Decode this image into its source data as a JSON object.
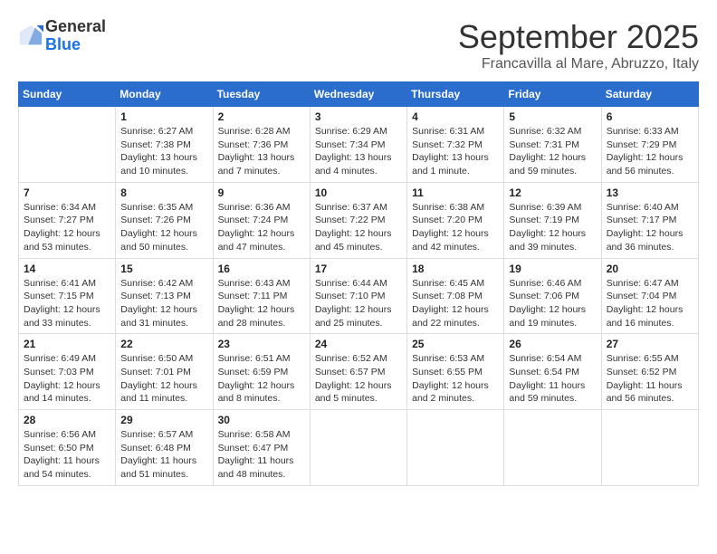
{
  "logo": {
    "general": "General",
    "blue": "Blue"
  },
  "title": {
    "month": "September 2025",
    "location": "Francavilla al Mare, Abruzzo, Italy"
  },
  "headers": [
    "Sunday",
    "Monday",
    "Tuesday",
    "Wednesday",
    "Thursday",
    "Friday",
    "Saturday"
  ],
  "weeks": [
    [
      {
        "day": "",
        "info": ""
      },
      {
        "day": "1",
        "info": "Sunrise: 6:27 AM\nSunset: 7:38 PM\nDaylight: 13 hours\nand 10 minutes."
      },
      {
        "day": "2",
        "info": "Sunrise: 6:28 AM\nSunset: 7:36 PM\nDaylight: 13 hours\nand 7 minutes."
      },
      {
        "day": "3",
        "info": "Sunrise: 6:29 AM\nSunset: 7:34 PM\nDaylight: 13 hours\nand 4 minutes."
      },
      {
        "day": "4",
        "info": "Sunrise: 6:31 AM\nSunset: 7:32 PM\nDaylight: 13 hours\nand 1 minute."
      },
      {
        "day": "5",
        "info": "Sunrise: 6:32 AM\nSunset: 7:31 PM\nDaylight: 12 hours\nand 59 minutes."
      },
      {
        "day": "6",
        "info": "Sunrise: 6:33 AM\nSunset: 7:29 PM\nDaylight: 12 hours\nand 56 minutes."
      }
    ],
    [
      {
        "day": "7",
        "info": "Sunrise: 6:34 AM\nSunset: 7:27 PM\nDaylight: 12 hours\nand 53 minutes."
      },
      {
        "day": "8",
        "info": "Sunrise: 6:35 AM\nSunset: 7:26 PM\nDaylight: 12 hours\nand 50 minutes."
      },
      {
        "day": "9",
        "info": "Sunrise: 6:36 AM\nSunset: 7:24 PM\nDaylight: 12 hours\nand 47 minutes."
      },
      {
        "day": "10",
        "info": "Sunrise: 6:37 AM\nSunset: 7:22 PM\nDaylight: 12 hours\nand 45 minutes."
      },
      {
        "day": "11",
        "info": "Sunrise: 6:38 AM\nSunset: 7:20 PM\nDaylight: 12 hours\nand 42 minutes."
      },
      {
        "day": "12",
        "info": "Sunrise: 6:39 AM\nSunset: 7:19 PM\nDaylight: 12 hours\nand 39 minutes."
      },
      {
        "day": "13",
        "info": "Sunrise: 6:40 AM\nSunset: 7:17 PM\nDaylight: 12 hours\nand 36 minutes."
      }
    ],
    [
      {
        "day": "14",
        "info": "Sunrise: 6:41 AM\nSunset: 7:15 PM\nDaylight: 12 hours\nand 33 minutes."
      },
      {
        "day": "15",
        "info": "Sunrise: 6:42 AM\nSunset: 7:13 PM\nDaylight: 12 hours\nand 31 minutes."
      },
      {
        "day": "16",
        "info": "Sunrise: 6:43 AM\nSunset: 7:11 PM\nDaylight: 12 hours\nand 28 minutes."
      },
      {
        "day": "17",
        "info": "Sunrise: 6:44 AM\nSunset: 7:10 PM\nDaylight: 12 hours\nand 25 minutes."
      },
      {
        "day": "18",
        "info": "Sunrise: 6:45 AM\nSunset: 7:08 PM\nDaylight: 12 hours\nand 22 minutes."
      },
      {
        "day": "19",
        "info": "Sunrise: 6:46 AM\nSunset: 7:06 PM\nDaylight: 12 hours\nand 19 minutes."
      },
      {
        "day": "20",
        "info": "Sunrise: 6:47 AM\nSunset: 7:04 PM\nDaylight: 12 hours\nand 16 minutes."
      }
    ],
    [
      {
        "day": "21",
        "info": "Sunrise: 6:49 AM\nSunset: 7:03 PM\nDaylight: 12 hours\nand 14 minutes."
      },
      {
        "day": "22",
        "info": "Sunrise: 6:50 AM\nSunset: 7:01 PM\nDaylight: 12 hours\nand 11 minutes."
      },
      {
        "day": "23",
        "info": "Sunrise: 6:51 AM\nSunset: 6:59 PM\nDaylight: 12 hours\nand 8 minutes."
      },
      {
        "day": "24",
        "info": "Sunrise: 6:52 AM\nSunset: 6:57 PM\nDaylight: 12 hours\nand 5 minutes."
      },
      {
        "day": "25",
        "info": "Sunrise: 6:53 AM\nSunset: 6:55 PM\nDaylight: 12 hours\nand 2 minutes."
      },
      {
        "day": "26",
        "info": "Sunrise: 6:54 AM\nSunset: 6:54 PM\nDaylight: 11 hours\nand 59 minutes."
      },
      {
        "day": "27",
        "info": "Sunrise: 6:55 AM\nSunset: 6:52 PM\nDaylight: 11 hours\nand 56 minutes."
      }
    ],
    [
      {
        "day": "28",
        "info": "Sunrise: 6:56 AM\nSunset: 6:50 PM\nDaylight: 11 hours\nand 54 minutes."
      },
      {
        "day": "29",
        "info": "Sunrise: 6:57 AM\nSunset: 6:48 PM\nDaylight: 11 hours\nand 51 minutes."
      },
      {
        "day": "30",
        "info": "Sunrise: 6:58 AM\nSunset: 6:47 PM\nDaylight: 11 hours\nand 48 minutes."
      },
      {
        "day": "",
        "info": ""
      },
      {
        "day": "",
        "info": ""
      },
      {
        "day": "",
        "info": ""
      },
      {
        "day": "",
        "info": ""
      }
    ]
  ]
}
